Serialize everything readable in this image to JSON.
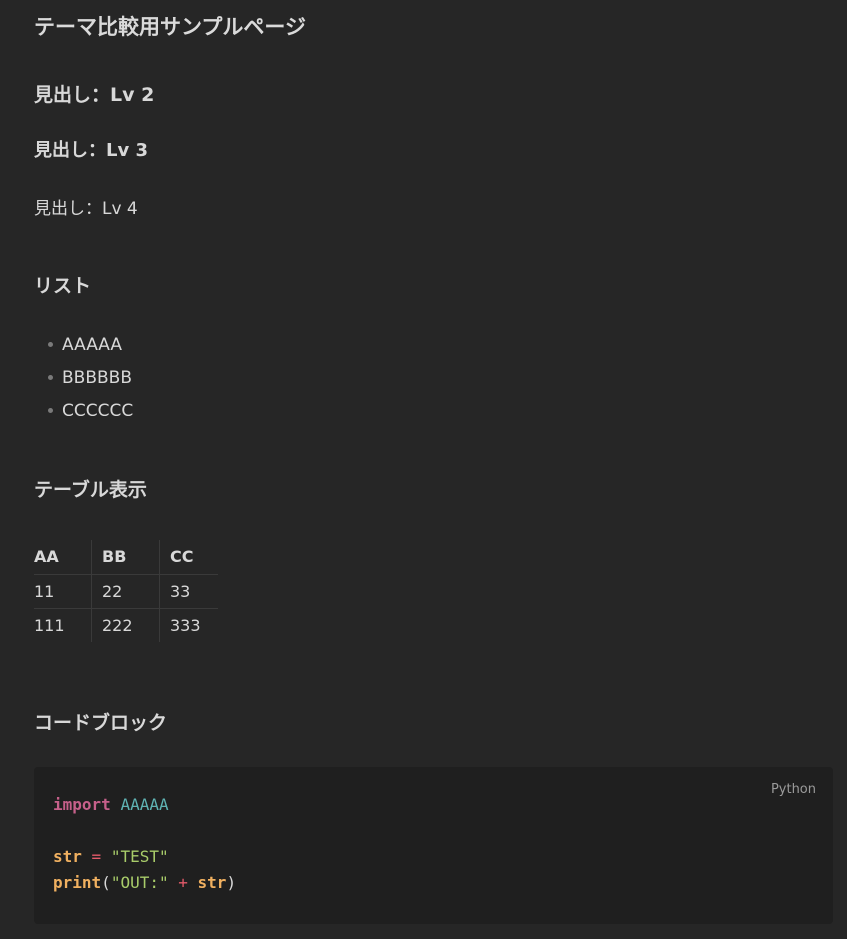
{
  "page": {
    "title": "テーマ比較用サンプルページ",
    "h2": "見出し：Lv 2",
    "h3": "見出し：Lv 3",
    "h4": "見出し：Lv 4"
  },
  "list_section": {
    "title": "リスト",
    "items": [
      "AAAAA",
      "BBBBBB",
      "CCCCCC"
    ]
  },
  "table_section": {
    "title": "テーブル表示",
    "headers": [
      "AA",
      "BB",
      "CC"
    ],
    "rows": [
      [
        "11",
        "22",
        "33"
      ],
      [
        "111",
        "222",
        "333"
      ]
    ]
  },
  "code_section": {
    "title": "コードブロック",
    "language": "Python",
    "tokens": {
      "import_kw": "import",
      "module": "AAAAA",
      "var_str": "str",
      "assign": "=",
      "test_str": "\"TEST\"",
      "print_fn": "print",
      "paren_open": "(",
      "out_str": "\"OUT:\"",
      "plus": "+",
      "var_str2": "str",
      "paren_close": ")"
    }
  },
  "colors": {
    "background": "#262626",
    "code_background": "#1f1f1f",
    "keyword": "#c6608a",
    "module": "#5fb3b3",
    "variable": "#f0b060",
    "operator": "#e45a6a",
    "string": "#a8cc6a"
  }
}
